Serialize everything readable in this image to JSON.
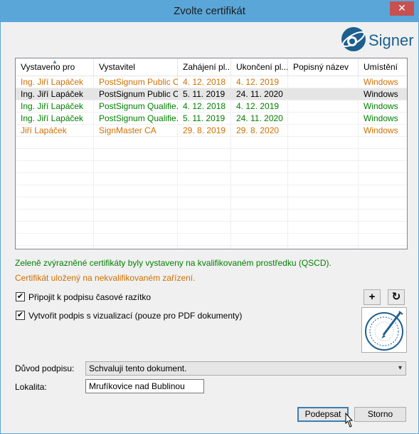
{
  "window": {
    "title": "Zvolte certifikát",
    "close_glyph": "✕"
  },
  "logo": {
    "text": "Signer",
    "icon": "signer-logo-icon"
  },
  "table": {
    "sort_glyph": "▲",
    "headers": [
      "Vystaveno pro",
      "Vystavitel",
      "Zahájení pl...",
      "Ukončení pl...",
      "Popisný název",
      "Umístění"
    ],
    "rows": [
      {
        "color": "#d07000",
        "cells": [
          "Ing. Jiří Lapáček",
          "PostSignum Public C...",
          "4. 12. 2018",
          "4. 12. 2019",
          "",
          "Windows"
        ]
      },
      {
        "color": "#000000",
        "cells": [
          "Ing. Jiří Lapáček",
          "PostSignum Public C...",
          "5. 11. 2019",
          "24. 11. 2020",
          "",
          "Windows"
        ]
      },
      {
        "color": "#008000",
        "cells": [
          "Ing. Jiří Lapáček",
          "PostSignum Qualifie...",
          "4. 12. 2018",
          "4. 12. 2019",
          "",
          "Windows"
        ]
      },
      {
        "color": "#008000",
        "cells": [
          "Ing. Jiří Lapáček",
          "PostSignum Qualifie...",
          "5. 11. 2019",
          "24. 11. 2020",
          "",
          "Windows"
        ]
      },
      {
        "color": "#d07000",
        "cells": [
          "Jiří Lapáček",
          "SignMaster CA",
          "29. 8. 2019",
          "29. 8. 2020",
          "",
          "Windows"
        ]
      }
    ]
  },
  "legend": {
    "green": "Zeleně zvýrazněné certifikáty byly vystaveny na kvalifikovaném prostředku (QSCD).",
    "orange": "Certifikát uložený na nekvalifikovaném zařízení."
  },
  "options": {
    "timestamp": {
      "label": "Připojit k podpisu časové razítko",
      "checked_glyph": "✔"
    },
    "visual": {
      "label": "Vytvořit podpis s vizualizací (pouze pro PDF dokumenty)",
      "checked_glyph": "✔"
    },
    "add_glyph": "+",
    "refresh_glyph": "↻"
  },
  "form": {
    "reason_label": "Důvod podpisu:",
    "reason_value": "Schvaluji tento dokument.",
    "reason_arrow": "▾",
    "location_label": "Lokalita:",
    "location_value": "Mrufíkovice nad Bublinou"
  },
  "buttons": {
    "sign": "Podepsat",
    "cancel": "Storno"
  }
}
